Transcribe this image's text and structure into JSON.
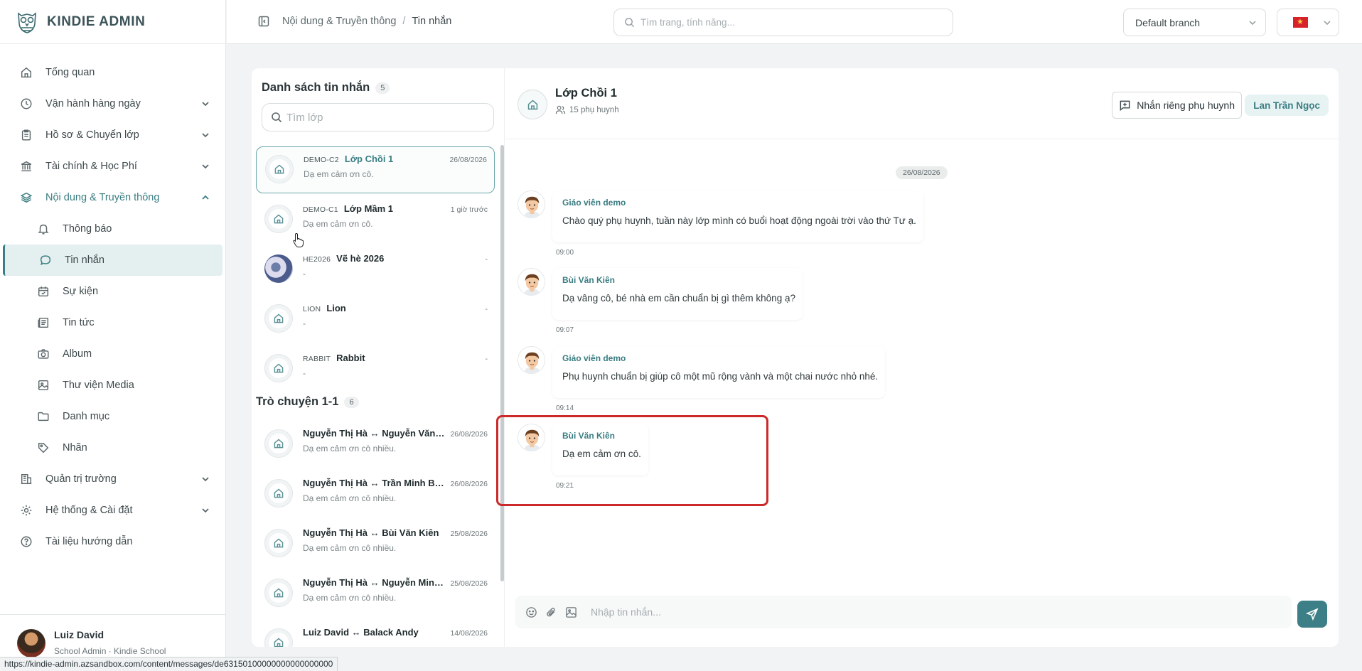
{
  "brand": {
    "name": "KINDIE ADMIN"
  },
  "sidebar": {
    "items": [
      {
        "label": "Tổng quan",
        "icon": "home-icon"
      },
      {
        "label": "Vận hành hàng ngày",
        "icon": "clock-icon"
      },
      {
        "label": "Hồ sơ & Chuyển lớp",
        "icon": "clipboard-icon"
      },
      {
        "label": "Tài chính & Học Phí",
        "icon": "bank-icon"
      },
      {
        "label": "Nội dung & Truyền thông",
        "icon": "layers-icon"
      },
      {
        "label": "Quản trị trường",
        "icon": "building-icon"
      },
      {
        "label": "Hệ thống & Cài đặt",
        "icon": "gear-icon"
      },
      {
        "label": "Tài liệu hướng dẫn",
        "icon": "help-icon"
      }
    ],
    "subitems": [
      {
        "label": "Thông báo",
        "icon": "bell-icon"
      },
      {
        "label": "Tin nhắn",
        "icon": "chat-icon"
      },
      {
        "label": "Sự kiện",
        "icon": "calendar-icon"
      },
      {
        "label": "Tin tức",
        "icon": "newspaper-icon"
      },
      {
        "label": "Album",
        "icon": "camera-icon"
      },
      {
        "label": "Thư viện Media",
        "icon": "image-icon"
      },
      {
        "label": "Danh mục",
        "icon": "folder-icon"
      },
      {
        "label": "Nhãn",
        "icon": "tag-icon"
      }
    ],
    "user": {
      "name": "Luiz David",
      "role": "School Admin · Kindie School"
    }
  },
  "header": {
    "breadcrumb": [
      "Nội dung & Truyền thông",
      "Tin nhắn"
    ],
    "search_placeholder": "Tìm trang, tính năng...",
    "branch": "Default branch"
  },
  "list": {
    "title": "Danh sách tin nhắn",
    "count": "5",
    "search_placeholder": "Tìm lớp",
    "classes": [
      {
        "code": "DEMO-C2",
        "name": "Lớp Chồi 1",
        "date": "26/08/2026",
        "preview": "Dạ em cảm ơn cô.",
        "active": true
      },
      {
        "code": "DEMO-C1",
        "name": "Lớp Mầm 1",
        "date": "1 giờ trước",
        "preview": "Dạ em cảm ơn cô."
      },
      {
        "code": "HE2026",
        "name": "Vẽ hè 2026",
        "date": "-",
        "preview": "-"
      },
      {
        "code": "LION",
        "name": "Lion",
        "date": "-",
        "preview": "-"
      },
      {
        "code": "RABBIT",
        "name": "Rabbit",
        "date": "-",
        "preview": "-"
      }
    ],
    "dm_title": "Trò chuyện 1-1",
    "dm_count": "6",
    "dms": [
      {
        "name": "Nguyễn Thị Hà ↔ Nguyễn Văn A...",
        "date": "26/08/2026",
        "preview": "Dạ em cảm ơn cô nhiều."
      },
      {
        "name": "Nguyễn Thị Hà ↔ Trần Minh Bình",
        "date": "26/08/2026",
        "preview": "Dạ em cảm ơn cô nhiều."
      },
      {
        "name": "Nguyễn Thị Hà ↔ Bùi Văn Kiên",
        "date": "25/08/2026",
        "preview": "Dạ em cảm ơn cô nhiều."
      },
      {
        "name": "Nguyễn Thị Hà ↔ Nguyễn Minh ...",
        "date": "25/08/2026",
        "preview": "Dạ em cảm ơn cô nhiều."
      },
      {
        "name": "Luiz David ↔ Balack Andy",
        "date": "14/08/2026",
        "preview": ""
      }
    ]
  },
  "chat": {
    "title": "Lớp Chồi 1",
    "subtitle": "15 phụ huynh",
    "private_button": "Nhắn riêng phụ huynh",
    "user_chip": "Lan Trần Ngọc",
    "date": "26/08/2026",
    "messages": [
      {
        "sender": "Giáo viên demo",
        "text": "Chào quý phụ huynh, tuần này lớp mình có buổi hoạt động ngoài trời vào thứ Tư ạ.",
        "time": "09:00"
      },
      {
        "sender": "Bùi Văn Kiên",
        "text": "Dạ vâng cô, bé nhà em cần chuẩn bị gì thêm không ạ?",
        "time": "09:07"
      },
      {
        "sender": "Giáo viên demo",
        "text": "Phụ huynh chuẩn bị giúp cô một mũ rộng vành và một chai nước nhỏ nhé.",
        "time": "09:14"
      },
      {
        "sender": "Bùi Văn Kiên",
        "text": "Dạ em cảm ơn cô.",
        "time": "09:21"
      }
    ],
    "input_placeholder": "Nhập tin nhắn..."
  },
  "status_url": "https://kindie-admin.azsandbox.com/content/messages/de63150100000000000000000",
  "colors": {
    "accent": "#3a7d82",
    "highlight": "#cc2a2a"
  }
}
